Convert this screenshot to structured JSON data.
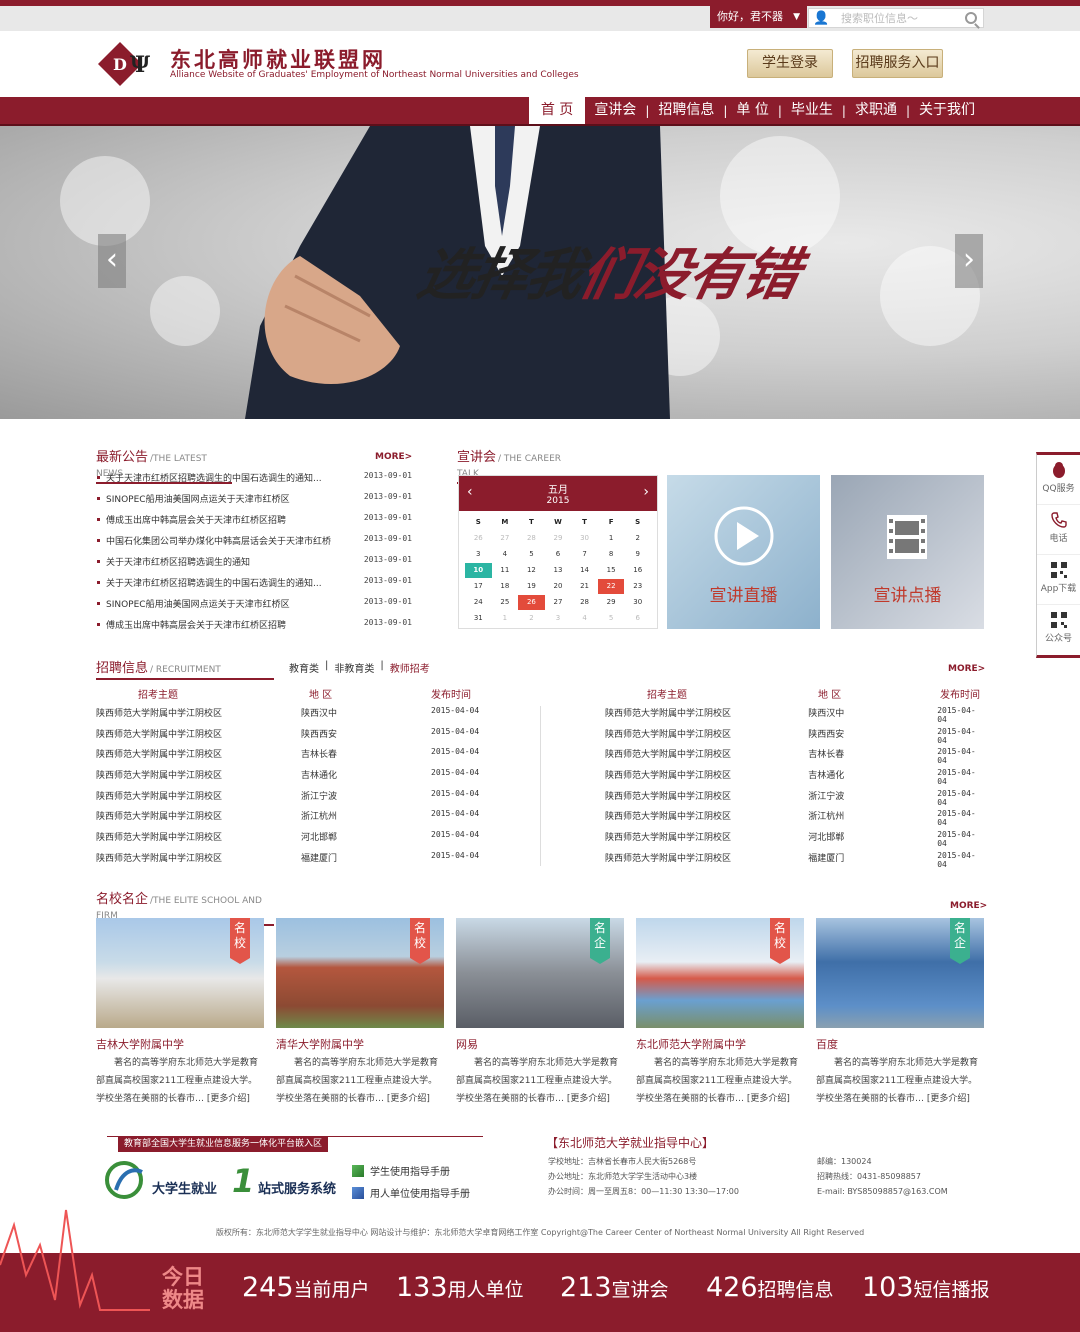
{
  "topbar": {
    "greeting": "你好，君不器",
    "search_placeholder": "搜索职位信息～"
  },
  "logo": {
    "name_cn": "东北高师就业联盟网",
    "name_en": "Alliance Website of Graduates' Employment of Northeast Normal Universities and Colleges"
  },
  "header_buttons": {
    "student_login": "学生登录",
    "recruit_entry": "招聘服务入口"
  },
  "nav": [
    "首 页",
    "宣讲会",
    "招聘信息",
    "单 位",
    "毕业生",
    "求职通",
    "关于我们"
  ],
  "banner": {
    "slogan_black": "选择我",
    "slogan_red": "们没有错"
  },
  "news": {
    "title": "最新公告",
    "title_en": "/THE LATEST NEWS",
    "more": "MORE>",
    "items": [
      {
        "title": "关于天津市红桥区招聘选调生的中国石选调生的通知...",
        "date": "2013-09-01"
      },
      {
        "title": "SINOPEC船用油美国网点运关于天津市红桥区",
        "date": "2013-09-01"
      },
      {
        "title": "傅成玉出席中韩高层会关于天津市红桥区招聘",
        "date": "2013-09-01"
      },
      {
        "title": "中国石化集团公司举办煤化中韩高层话会关于天津市红桥",
        "date": "2013-09-01"
      },
      {
        "title": "关于天津市红桥区招聘选调生的通知",
        "date": "2013-09-01"
      },
      {
        "title": "关于天津市红桥区招聘选调生的中国石选调生的通知...",
        "date": "2013-09-01"
      },
      {
        "title": "SINOPEC船用油美国网点运关于天津市红桥区",
        "date": "2013-09-01"
      },
      {
        "title": "傅成玉出席中韩高层会关于天津市红桥区招聘",
        "date": "2013-09-01"
      }
    ]
  },
  "talk": {
    "title": "宣讲会",
    "title_en": "/ THE CAREER TALK",
    "calendar": {
      "month": "五月",
      "year": "2015",
      "weekdays": [
        "S",
        "M",
        "T",
        "W",
        "T",
        "F",
        "S"
      ],
      "days": [
        {
          "d": "26",
          "t": "dim"
        },
        {
          "d": "27",
          "t": "dim"
        },
        {
          "d": "28",
          "t": "dim"
        },
        {
          "d": "29",
          "t": "dim"
        },
        {
          "d": "30",
          "t": "dim"
        },
        {
          "d": "1",
          "t": ""
        },
        {
          "d": "2",
          "t": ""
        },
        {
          "d": "3",
          "t": ""
        },
        {
          "d": "4",
          "t": ""
        },
        {
          "d": "5",
          "t": ""
        },
        {
          "d": "6",
          "t": ""
        },
        {
          "d": "7",
          "t": ""
        },
        {
          "d": "8",
          "t": ""
        },
        {
          "d": "9",
          "t": ""
        },
        {
          "d": "10",
          "t": "today"
        },
        {
          "d": "11",
          "t": ""
        },
        {
          "d": "12",
          "t": ""
        },
        {
          "d": "13",
          "t": ""
        },
        {
          "d": "14",
          "t": ""
        },
        {
          "d": "15",
          "t": ""
        },
        {
          "d": "16",
          "t": ""
        },
        {
          "d": "17",
          "t": ""
        },
        {
          "d": "18",
          "t": ""
        },
        {
          "d": "19",
          "t": ""
        },
        {
          "d": "20",
          "t": ""
        },
        {
          "d": "21",
          "t": ""
        },
        {
          "d": "22",
          "t": "ev"
        },
        {
          "d": "23",
          "t": ""
        },
        {
          "d": "24",
          "t": ""
        },
        {
          "d": "25",
          "t": ""
        },
        {
          "d": "26",
          "t": "ev"
        },
        {
          "d": "27",
          "t": ""
        },
        {
          "d": "28",
          "t": ""
        },
        {
          "d": "29",
          "t": ""
        },
        {
          "d": "30",
          "t": ""
        },
        {
          "d": "31",
          "t": ""
        },
        {
          "d": "1",
          "t": "dim"
        },
        {
          "d": "2",
          "t": "dim"
        },
        {
          "d": "3",
          "t": "dim"
        },
        {
          "d": "4",
          "t": "dim"
        },
        {
          "d": "5",
          "t": "dim"
        },
        {
          "d": "6",
          "t": "dim"
        }
      ]
    },
    "live_label": "宣讲直播",
    "vod_label": "宣讲点播"
  },
  "recruit": {
    "title": "招聘信息",
    "title_en": "/ RECRUITMENT",
    "tabs": [
      "教育类",
      "非教育类",
      "教师招考"
    ],
    "more": "MORE>",
    "headers": [
      "招考主题",
      "地 区",
      "发布时间"
    ],
    "rows": [
      {
        "topic": "陕西师范大学附属中学江阴校区",
        "region": "陕西汉中",
        "date": "2015-04-04"
      },
      {
        "topic": "陕西师范大学附属中学江阴校区",
        "region": "陕西西安",
        "date": "2015-04-04"
      },
      {
        "topic": "陕西师范大学附属中学江阴校区",
        "region": "吉林长春",
        "date": "2015-04-04"
      },
      {
        "topic": "陕西师范大学附属中学江阴校区",
        "region": "吉林通化",
        "date": "2015-04-04"
      },
      {
        "topic": "陕西师范大学附属中学江阴校区",
        "region": "浙江宁波",
        "date": "2015-04-04"
      },
      {
        "topic": "陕西师范大学附属中学江阴校区",
        "region": "浙江杭州",
        "date": "2015-04-04"
      },
      {
        "topic": "陕西师范大学附属中学江阴校区",
        "region": "河北邯郸",
        "date": "2015-04-04"
      },
      {
        "topic": "陕西师范大学附属中学江阴校区",
        "region": "福建厦门",
        "date": "2015-04-04"
      }
    ]
  },
  "elite": {
    "title": "名校名企",
    "title_en": "/THE ELITE SCHOOL AND FIRM",
    "more": "MORE>",
    "desc": "著名的高等学府东北师范大学是教育部直属高校国家211工程重点建设大学。学校坐落在美丽的长春市…",
    "desc_link": "[更多介绍]",
    "cards": [
      {
        "name": "吉林大学附属中学",
        "badge": "名校",
        "badge_color": "red"
      },
      {
        "name": "清华大学附属中学",
        "badge": "名校",
        "badge_color": "red"
      },
      {
        "name": "网易",
        "badge": "名企",
        "badge_color": "green"
      },
      {
        "name": "东北师范大学附属中学",
        "badge": "名校",
        "badge_color": "red"
      },
      {
        "name": "百度",
        "badge": "名企",
        "badge_color": "green"
      }
    ]
  },
  "footer": {
    "flag": "教育部全国大学生就业信息服务一体化平台嵌入区",
    "system_left": "大学生就业",
    "system_num": "1",
    "system_right": "站式服务系统",
    "guide_student": "学生使用指导手册",
    "guide_unit": "用人单位使用指导手册",
    "center_title": "【东北师范大学就业指导中心】",
    "address": "学校地址：吉林省长春市人民大街5268号",
    "office": "办公地址：东北师范大学学生活动中心3楼",
    "hours": "办公时间：周一至周五8：00—11:30 13:30—17:00",
    "zip": "邮编：130024",
    "hotline": "招聘热线：0431-85098857",
    "email": "E-mail: BYS85098857@163.COM",
    "copyright": "版权所有：东北师范大学学生就业指导中心    网站设计与维护：东北师范大学卓育网络工作室 Copyright@The Career Center of Northeast Normal University  All Right Reserved"
  },
  "stats": {
    "today_1": "今日",
    "today_2": "数据",
    "items": [
      {
        "num": "245",
        "label": "当前用户"
      },
      {
        "num": "133",
        "label": "用人单位"
      },
      {
        "num": "213",
        "label": "宣讲会"
      },
      {
        "num": "426",
        "label": "招聘信息"
      },
      {
        "num": "103",
        "label": "短信播报"
      }
    ]
  },
  "sidefloat": [
    "QQ服务",
    "电话",
    "App下载",
    "公众号"
  ]
}
